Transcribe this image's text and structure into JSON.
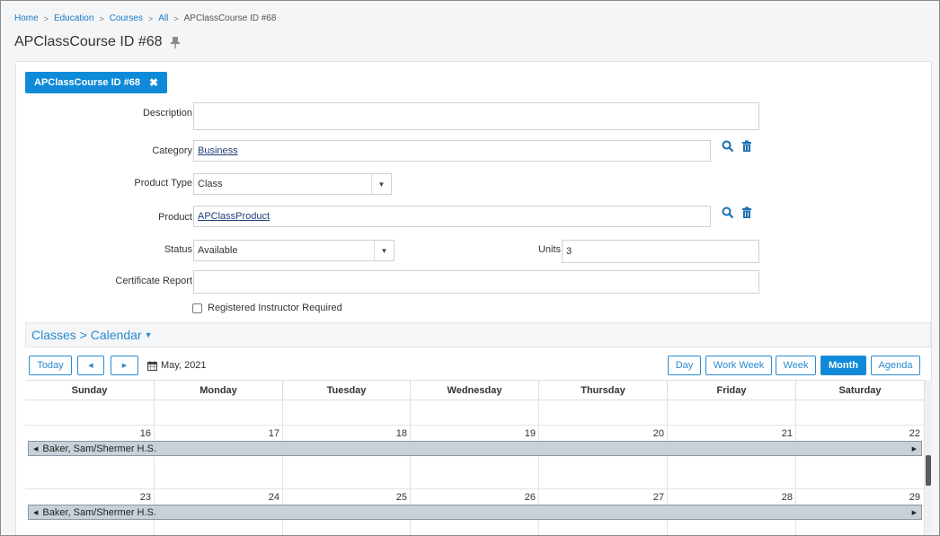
{
  "breadcrumb": {
    "items": [
      "Home",
      "Education",
      "Courses",
      "All"
    ],
    "current": "APClassCourse ID #68"
  },
  "page": {
    "title": "APClassCourse ID #68"
  },
  "record_tab": {
    "label": "APClassCourse ID #68"
  },
  "form": {
    "description": {
      "label": "Description",
      "value": ""
    },
    "category": {
      "label": "Category",
      "value": "Business"
    },
    "product_type": {
      "label": "Product Type",
      "value": "Class"
    },
    "product": {
      "label": "Product",
      "value": "APClassProduct"
    },
    "status": {
      "label": "Status",
      "value": "Available"
    },
    "units": {
      "label": "Units",
      "value": "3"
    },
    "certificate_report": {
      "label": "Certificate Report",
      "value": ""
    },
    "registered_instructor": {
      "label": "Registered Instructor Required",
      "checked": false
    }
  },
  "classes": {
    "header": "Classes > Calendar",
    "toolbar": {
      "today": "Today",
      "date": "May, 2021",
      "views": [
        "Day",
        "Work Week",
        "Week",
        "Month",
        "Agenda"
      ],
      "active_view": "Month"
    },
    "days": [
      "Sunday",
      "Monday",
      "Tuesday",
      "Wednesday",
      "Thursday",
      "Friday",
      "Saturday"
    ],
    "weeks": [
      {
        "dates": [
          "16",
          "17",
          "18",
          "19",
          "20",
          "21",
          "22"
        ],
        "event": "Baker, Sam/Shermer H.S."
      },
      {
        "dates": [
          "23",
          "24",
          "25",
          "26",
          "27",
          "28",
          "29"
        ],
        "event": "Baker, Sam/Shermer H.S."
      }
    ]
  },
  "colors": {
    "accent": "#0e8ad8",
    "link": "#1a7ac4",
    "event_bar": "#c9d1d8"
  }
}
